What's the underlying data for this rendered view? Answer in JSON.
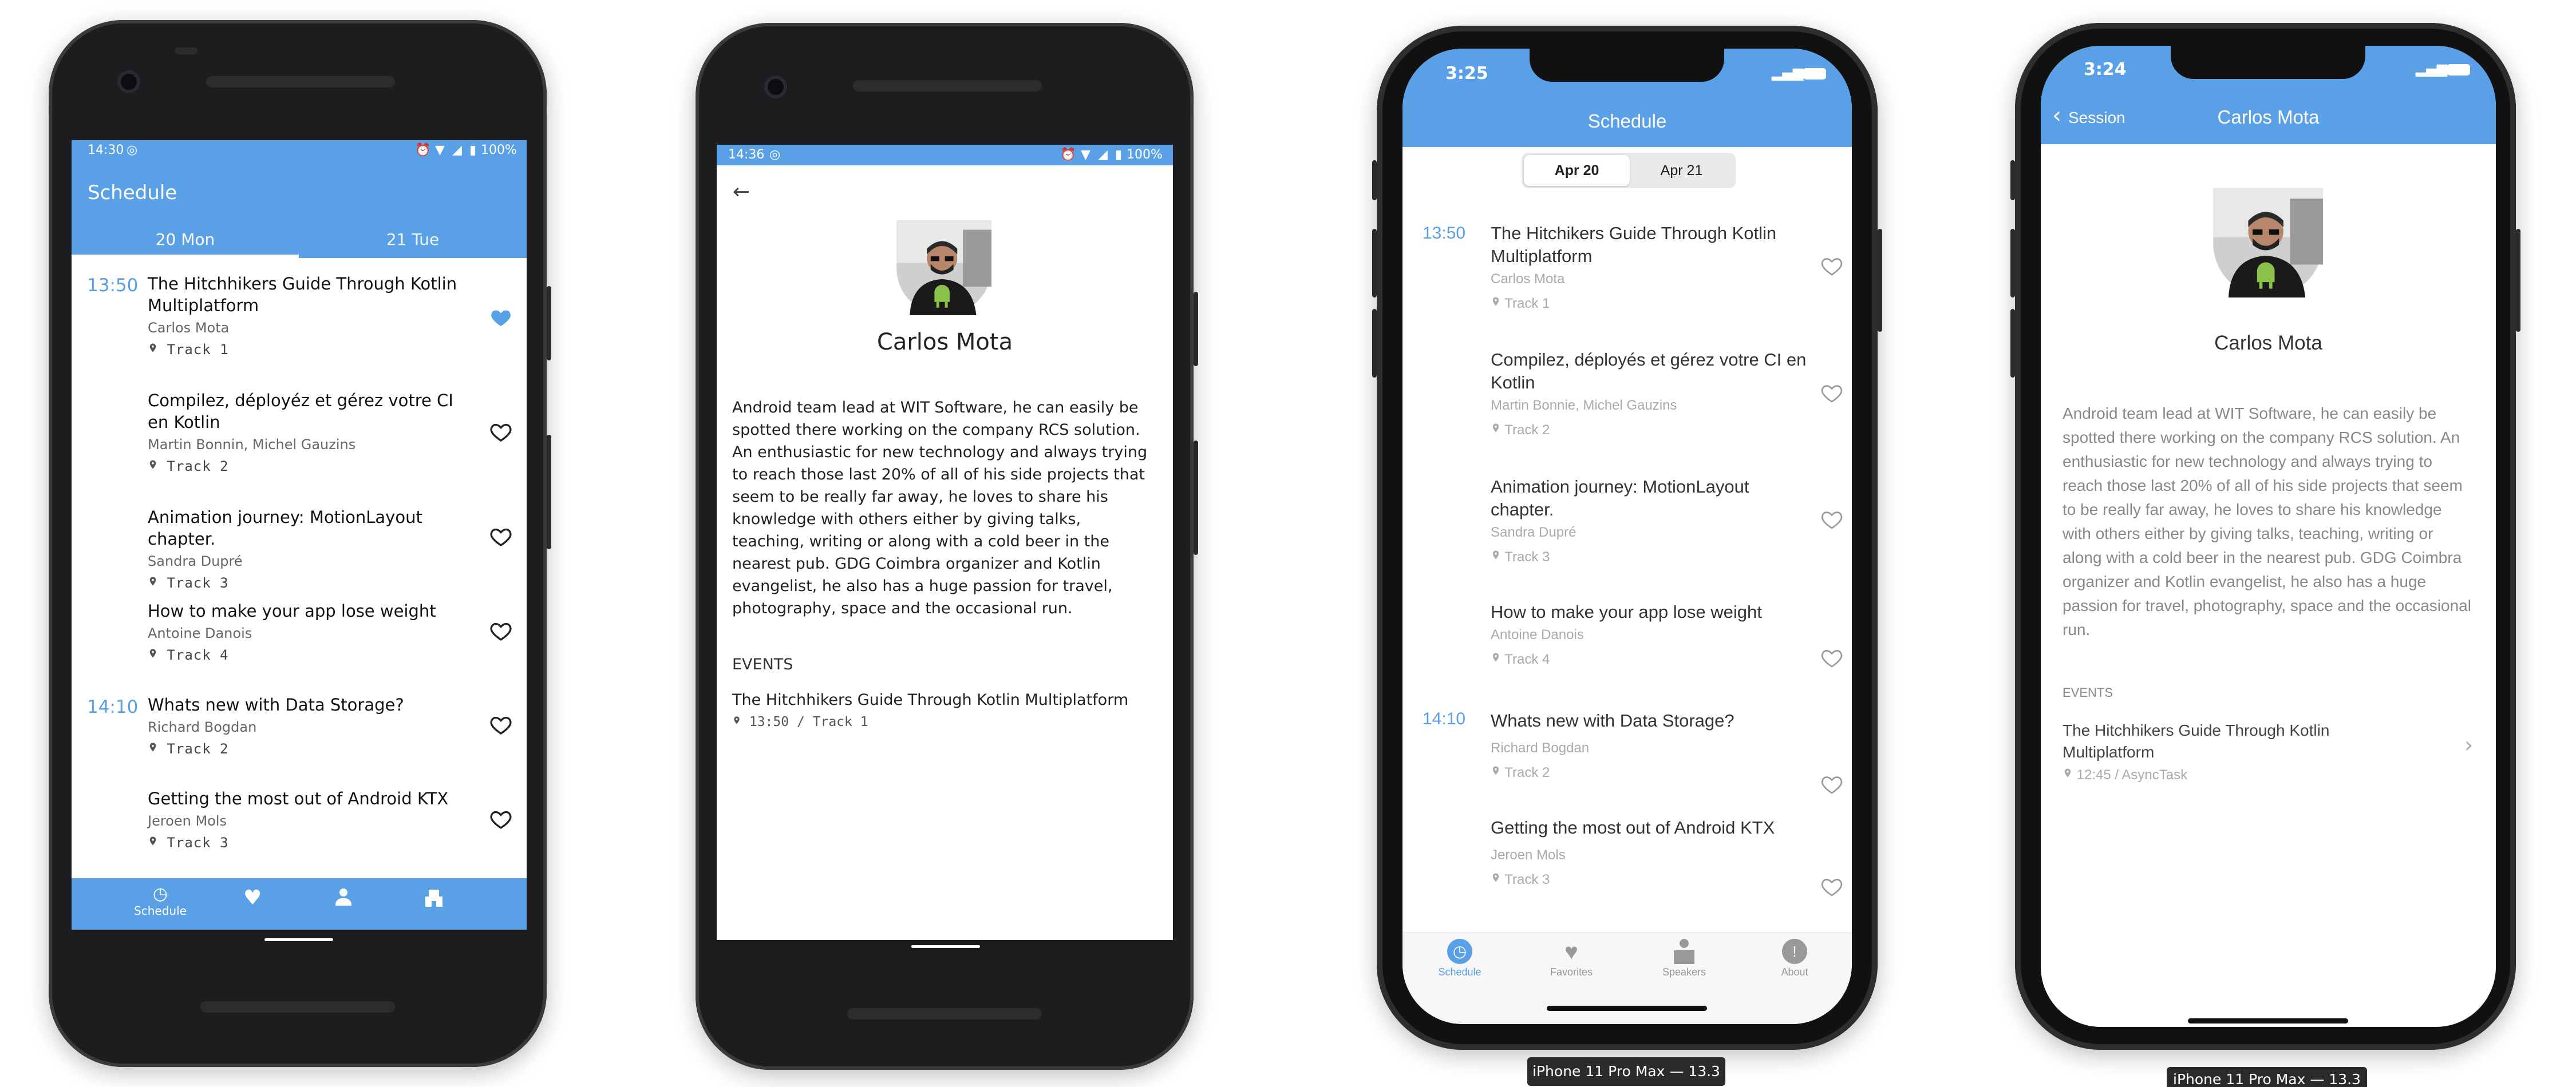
{
  "android1": {
    "status_time": "14:30",
    "status_battery": "100%",
    "app_title": "Schedule",
    "tabs": [
      "20 Mon",
      "21 Tue"
    ],
    "time_slots": [
      "13:50",
      "14:10"
    ],
    "sessions": [
      {
        "title": "The Hitchhikers Guide Through Kotlin Multiplatform",
        "speakers": "Carlos Mota",
        "room": "Track 1",
        "favorite": true
      },
      {
        "title": "Compilez, déployéz et gérez votre CI en Kotlin",
        "speakers": "Martin Bonnin, Michel Gauzins",
        "room": "Track 2",
        "favorite": false
      },
      {
        "title": "Animation journey: MotionLayout chapter.",
        "speakers": "Sandra Dupré",
        "room": "Track 3",
        "favorite": false
      },
      {
        "title": "How to make your app lose weight",
        "speakers": "Antoine Danois",
        "room": "Track 4",
        "favorite": false
      },
      {
        "title": "Whats new with Data Storage?",
        "speakers": "Richard Bogdan",
        "room": "Track 2",
        "favorite": false
      },
      {
        "title": "Getting the most out of Android KTX",
        "speakers": "Jeroen Mols",
        "room": "Track 3",
        "favorite": false
      }
    ],
    "bottom_nav": {
      "schedule_label": "Schedule"
    }
  },
  "android2": {
    "status_time": "14:36",
    "status_battery": "100%",
    "speaker_name": "Carlos Mota",
    "bio": "Android team lead at WIT Software, he can easily be spotted there working on the company RCS solution. An enthusiastic for new technology and always trying to reach those last 20% of all of his side projects that seem to be really far away, he loves to share his knowledge with others either by giving talks, teaching, writing or along with a cold beer in the nearest pub. GDG Coimbra organizer and Kotlin evangelist, he also has a huge passion for travel, photography, space and the occasional run.",
    "events_label": "EVENTS",
    "event_title": "The Hitchhikers Guide Through Kotlin Multiplatform",
    "event_meta": "13:50 / Track 1"
  },
  "ios1": {
    "status_time": "3:25",
    "nav_title": "Schedule",
    "segments": [
      "Apr 20",
      "Apr 21"
    ],
    "time_slots": [
      "13:50",
      "14:10"
    ],
    "sessions": [
      {
        "title": "The Hitchikers Guide Through Kotlin Multiplatform",
        "speakers": "Carlos Mota",
        "room": "Track 1"
      },
      {
        "title": "Compilez, déployés et gérez votre CI en Kotlin",
        "speakers": "Martin Bonnie, Michel Gauzins",
        "room": "Track 2"
      },
      {
        "title": "Animation journey: MotionLayout chapter.",
        "speakers": "Sandra Dupré",
        "room": "Track 3"
      },
      {
        "title": "How to make your app lose weight",
        "speakers": "Antoine Danois",
        "room": "Track 4"
      },
      {
        "title": "Whats new with Data Storage?",
        "speakers": "Richard Bogdan",
        "room": "Track 2"
      },
      {
        "title": "Getting the most out of Android KTX",
        "speakers": "Jeroen Mols",
        "room": "Track 3"
      }
    ],
    "tabbar": [
      "Schedule",
      "Favorites",
      "Speakers",
      "About"
    ],
    "device_label": "iPhone 11 Pro Max — 13.3"
  },
  "ios2": {
    "status_time": "3:24",
    "back_label": "Session",
    "nav_title": "Carlos Mota",
    "speaker_name": "Carlos Mota",
    "bio": "Android team lead at WIT Software, he can easily be spotted there working on the company RCS solution. An enthusiastic for new technology and always trying to reach those last 20% of all of his side projects that seem to be really far away, he loves to share his knowledge with others either by giving talks, teaching, writing or along with a cold beer in the nearest pub. GDG Coimbra organizer and Kotlin evangelist, he also has a huge passion for travel, photography, space and the occasional run.",
    "events_label": "EVENTS",
    "event_title": "The Hitchhikers Guide Through Kotlin Multiplatform",
    "event_time": "12:45",
    "event_room": "/ AsyncTask",
    "device_label": "iPhone 11 Pro Max — 13.3"
  },
  "colors": {
    "accent": "#5aa0e6",
    "frame": "#1d1d1f"
  }
}
